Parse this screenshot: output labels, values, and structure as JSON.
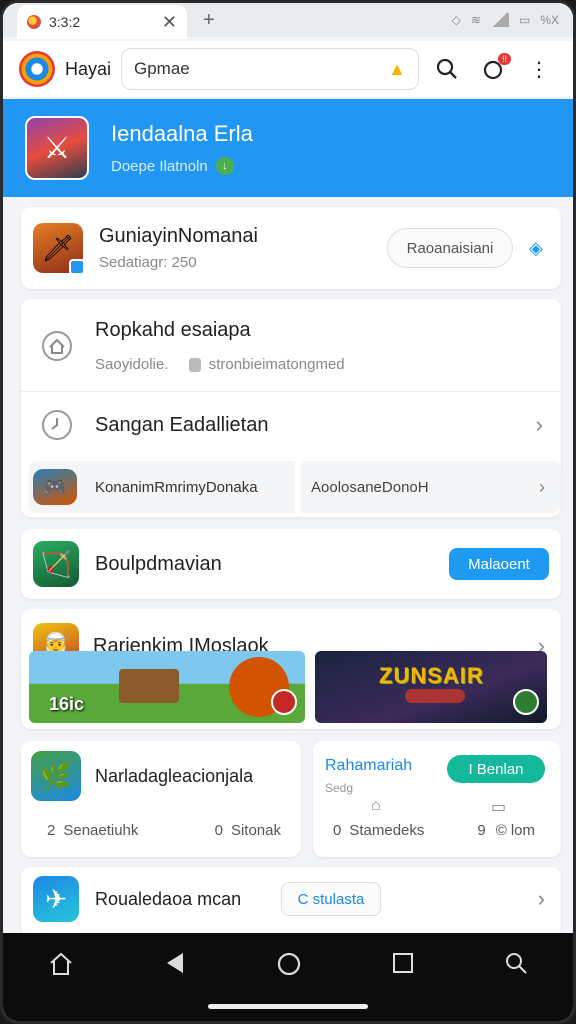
{
  "status": {
    "tab_title": "3:3:2",
    "close": "✕",
    "plus": "+",
    "right_text": "%X"
  },
  "appbar": {
    "app_name": "Hayai",
    "search_value": "Gpmae"
  },
  "hero": {
    "title": "Iendaalna Erla",
    "subtitle": "Doepe Ilatnoln"
  },
  "card1": {
    "title": "GuniayinNomanai",
    "subtitle": "Sedatiagr: 250",
    "button": "Raoanaisiani"
  },
  "card2": {
    "title": "Ropkahd esaiapa",
    "subtitle_left": "Saoyidolie.",
    "subtitle_right": "stronbieimatongmed",
    "row2_title": "Sangan Eadallietan",
    "strip_left": "KonanimRmrimyDonaka",
    "strip_right": "AoolosaneDonoH"
  },
  "card3": {
    "title": "Boulpdmavian",
    "button": "Malaoent"
  },
  "card4": {
    "title": "Rarienkim IMoslaok",
    "banner1_tag": "16ic",
    "banner2_logo": "ZUNSAIR"
  },
  "card5": {
    "title": "Narladagleacionjala",
    "stat1_num": "2",
    "stat1_label": "Senaetiuhk",
    "stat2_num": "0",
    "stat2_label": "Sitonak"
  },
  "card6": {
    "title": "Rahamariah",
    "sub": "Sedg",
    "button": "I Benlan",
    "stat1_num": "0",
    "stat1_label": "Stamedeks",
    "stat2_num": "9",
    "stat2_label": "lom"
  },
  "card7": {
    "title": "Roualedaoa mcan",
    "button": "C stulasta"
  },
  "colors": {
    "accent": "#2196f3",
    "teal": "#13b99a",
    "badge": "#e53935"
  }
}
